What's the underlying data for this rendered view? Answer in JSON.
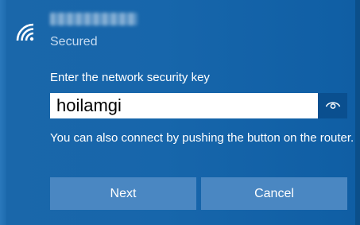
{
  "network": {
    "name": "",
    "status": "Secured"
  },
  "security": {
    "prompt": "Enter the network security key",
    "key_value": "hoilamgi",
    "help_text": "You can also connect by pushing the button on the router."
  },
  "actions": {
    "next_label": "Next",
    "cancel_label": "Cancel"
  },
  "icons": {
    "wifi": "wifi-icon",
    "reveal": "eye-icon"
  },
  "colors": {
    "panel_bg": "#1766ab",
    "button_bg": "#4a87c2",
    "reveal_bg": "#0a4f8f"
  }
}
